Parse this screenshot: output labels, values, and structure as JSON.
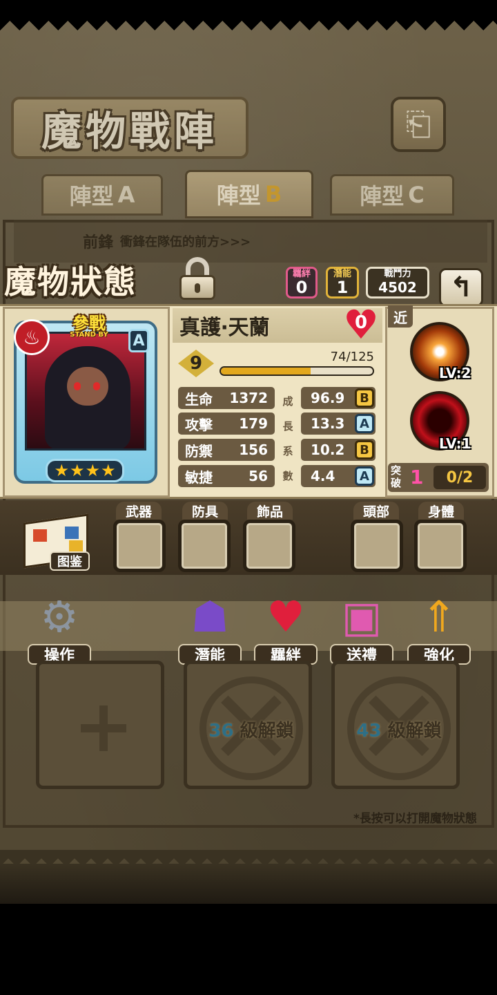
{
  "header": {
    "title": "魔物戰陣",
    "back_icon": "return-arrow-icon",
    "tabs": [
      {
        "label": "陣型",
        "suffix": "A"
      },
      {
        "label": "陣型",
        "suffix": "B"
      },
      {
        "label": "陣型",
        "suffix": "C"
      }
    ],
    "active_tab": 1,
    "front_row_label": "前鋒",
    "front_row_hint": "衝鋒在隊伍的前方>>>"
  },
  "status": {
    "title": "魔物狀態",
    "lock_icon": "padlock-icon",
    "bond_label": "羈絆",
    "bond_value": "0",
    "potential_label": "潛能",
    "potential_value": "1",
    "power_label": "戰鬥力",
    "power_value": "4502",
    "back2_icon": "return-arrow-icon"
  },
  "monster": {
    "standby_title": "參戰",
    "standby_sub": "STAND BY",
    "element_icon": "fire-icon",
    "rank": "A",
    "stars": 4,
    "name": "真護‧天蘭",
    "hearts": "0",
    "level": "9",
    "xp_text": "74/125",
    "xp_fraction": 0.592,
    "stats": [
      {
        "label": "生命",
        "value": "1372",
        "growth": "96.9",
        "grade": "B"
      },
      {
        "label": "攻擊",
        "value": "179",
        "growth": "13.3",
        "grade": "A"
      },
      {
        "label": "防禦",
        "value": "156",
        "growth": "10.2",
        "grade": "B"
      },
      {
        "label": "敏捷",
        "value": "56",
        "growth": "4.4",
        "grade": "A"
      }
    ],
    "growth_vertical_labels": [
      "成",
      "長",
      "系",
      "數"
    ]
  },
  "skills": {
    "range": "近",
    "skill1_level": "LV:2",
    "skill2_level": "LV:1",
    "breakthrough_label": "突破",
    "breakthrough_value": "1",
    "breakthrough_count": "0/2"
  },
  "equipment": {
    "book_label": "图鉴",
    "slots": [
      "武器",
      "防具",
      "飾品",
      "頭部",
      "身體"
    ]
  },
  "actions": [
    {
      "label": "操作",
      "icon": "gear-icon"
    },
    {
      "label": "潛能",
      "icon": "demon-icon"
    },
    {
      "label": "羈絆",
      "icon": "hearts-icon"
    },
    {
      "label": "送禮",
      "icon": "gift-icon"
    },
    {
      "label": "強化",
      "icon": "up-arrows-icon"
    }
  ],
  "team_slots": [
    {
      "type": "empty"
    },
    {
      "type": "locked",
      "level": "36",
      "text": "級解鎖"
    },
    {
      "type": "locked",
      "level": "43",
      "text": "級解鎖"
    }
  ],
  "footer_hint": "*長按可以打開魔物狀態"
}
